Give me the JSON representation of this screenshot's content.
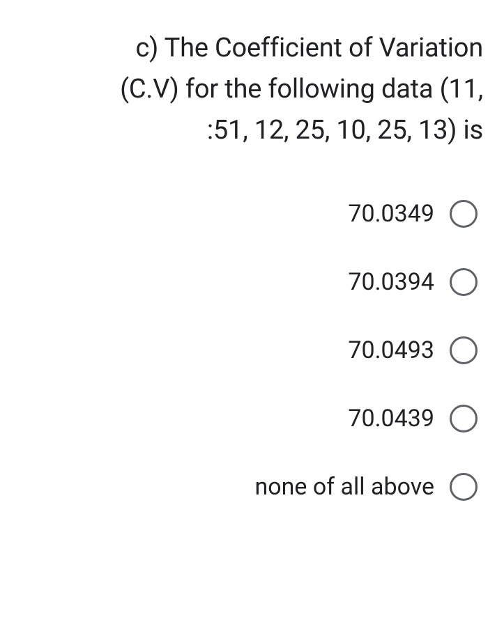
{
  "question": {
    "line1": "c) The Coefficient of Variation",
    "line2": "(C.V) for the following data (11,",
    "line3": ":51, 12, 25, 10, 25, 13) is"
  },
  "options": [
    {
      "label": "70.0349"
    },
    {
      "label": "70.0394"
    },
    {
      "label": "70.0493"
    },
    {
      "label": "70.0439"
    },
    {
      "label": "none of all above"
    }
  ]
}
